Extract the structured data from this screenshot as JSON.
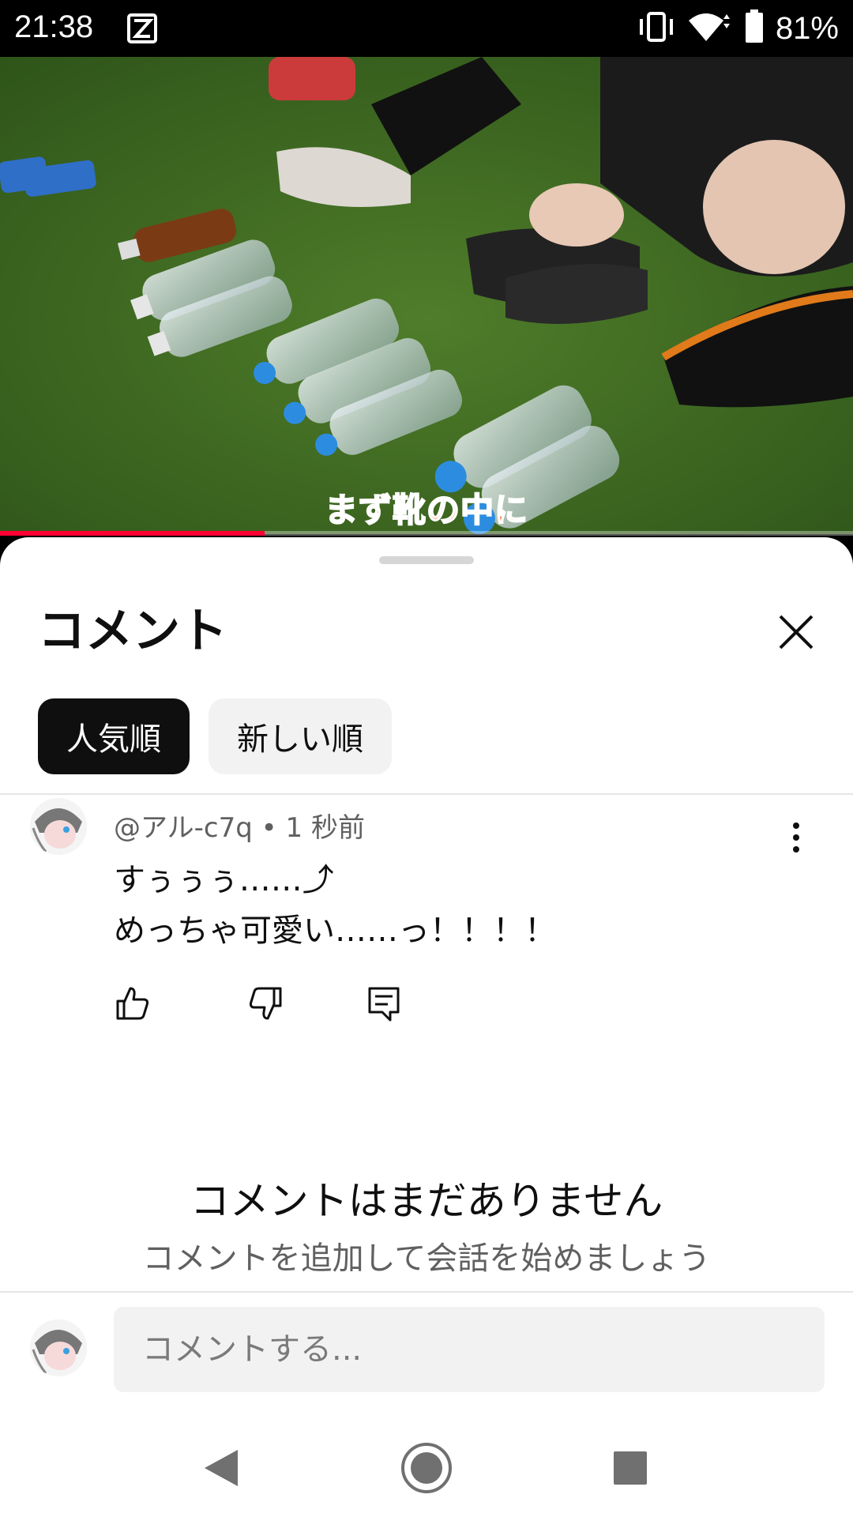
{
  "status_bar": {
    "time": "21:38",
    "battery": "81%",
    "icons": [
      "app-notification-icon",
      "vibrate-icon",
      "wifi-icon",
      "battery-icon"
    ]
  },
  "video": {
    "caption": "まず靴の中に",
    "progress": 0.31
  },
  "sheet": {
    "title": "コメント",
    "chips": [
      {
        "label": "人気順",
        "selected": true
      },
      {
        "label": "新しい順",
        "selected": false
      }
    ]
  },
  "comment": {
    "author": "@アル-c7q",
    "time_ago": "1 秒前",
    "meta_separator": " • ",
    "lines": [
      "すぅぅぅ……⤴︎",
      "めっちゃ可愛い……っ！！！！"
    ],
    "icons": [
      "like-icon",
      "dislike-icon",
      "reply-icon",
      "more-vert-icon"
    ]
  },
  "empty_state": {
    "title": "コメントはまだありません",
    "subtitle": "コメントを追加して会話を始めましょう"
  },
  "composer": {
    "placeholder": "コメントする..."
  },
  "colors": {
    "accent_red": "#ff0033",
    "chip_active_bg": "#0f0f0f",
    "chip_inactive_bg": "#f2f2f2",
    "secondary_text": "#606060"
  }
}
